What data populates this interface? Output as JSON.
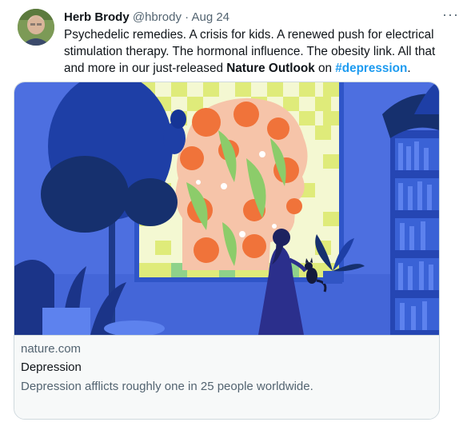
{
  "author": {
    "name": "Herb Brody",
    "handle": "@hbrody",
    "separator": "·",
    "date": "Aug 24"
  },
  "menu": {
    "more_label": "···"
  },
  "tweet": {
    "text_before": "Psychedelic remedies. A crisis for kids. A renewed push for electrical stimulation therapy. The hormonal influence. The obesity link. All that and more in our just-released ",
    "bold_link": "Nature Outlook",
    "text_middle": " on ",
    "hashtag": "#depression",
    "text_after": "."
  },
  "card": {
    "domain": "nature.com",
    "title": "Depression",
    "description": "Depression afflicts roughly one in 25 people worldwide."
  },
  "colors": {
    "hashtag": "#1d9bf0",
    "secondary_text": "#536471",
    "illustration_bg": "#4d6fe0",
    "window_yellow": "#e4f08a",
    "flower_orange": "#f0733a"
  }
}
